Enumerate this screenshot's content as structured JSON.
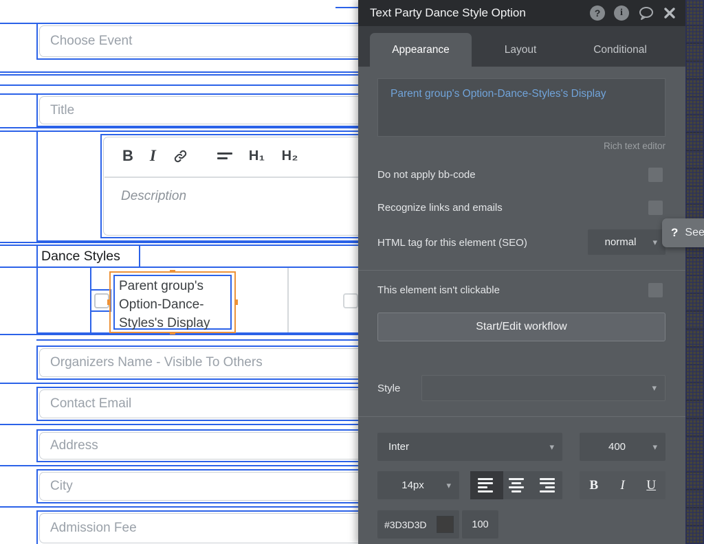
{
  "canvas": {
    "top_inputs": [
      {
        "placeholder": "Choose Event"
      },
      {
        "placeholder": "Title"
      }
    ],
    "rich_editor": {
      "toolbar": {
        "bold": "B",
        "italic": "I",
        "h1": "H₁",
        "h2": "H₂"
      },
      "placeholder": "Description"
    },
    "dance_styles_label": "Dance Styles",
    "selected_element_text": "Parent group's Option-Dance-Styles's Display",
    "bottom_inputs": [
      {
        "placeholder": "Organizers Name - Visible To Others"
      },
      {
        "placeholder": "Contact Email"
      },
      {
        "placeholder": "Address"
      },
      {
        "placeholder": "City"
      },
      {
        "placeholder": "Admission Fee"
      }
    ]
  },
  "panel": {
    "title": "Text Party Dance Style Option",
    "icons": {
      "help": "?",
      "info": "i"
    },
    "tabs": [
      {
        "label": "Appearance"
      },
      {
        "label": "Layout"
      },
      {
        "label": "Conditional"
      }
    ],
    "rich_text_value": "Parent group's Option-Dance-Styles's Display",
    "rich_text_hint": "Rich text editor",
    "bb_code_label": "Do not apply bb-code",
    "links_label": "Recognize links and emails",
    "seo_label": "HTML tag for this element (SEO)",
    "seo_value": "normal",
    "clickable_label": "This element isn't clickable",
    "workflow_button_label": "Start/Edit workflow",
    "style_label": "Style",
    "font_family": "Inter",
    "font_weight": "400",
    "font_size": "14px",
    "bold_label": "B",
    "italic_label": "I",
    "underline_label": "U",
    "color_hex": "#3D3D3D",
    "opacity_value": "100",
    "tooltip_q": "?",
    "tooltip_text": "See"
  },
  "colors": {
    "selection_blue": "#2B62E8",
    "selection_orange": "#ED9238",
    "expression_blue": "#71A4DA",
    "text_color_value": "#3D3D3D"
  }
}
